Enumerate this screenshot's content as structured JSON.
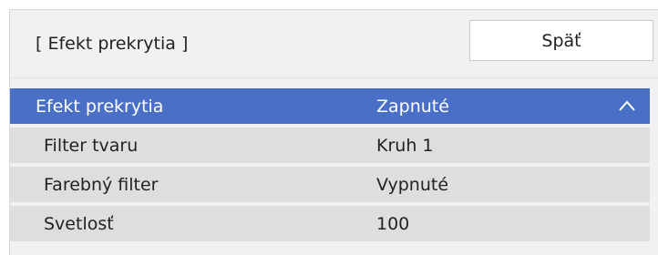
{
  "header": {
    "title": "[ Efekt prekrytia ]",
    "back_label": "Späť"
  },
  "menu": {
    "items": [
      {
        "label": "Efekt prekrytia",
        "value": "Zapnuté",
        "selected": true,
        "icon": "chevron-up-icon"
      },
      {
        "label": "Filter tvaru",
        "value": "Kruh 1"
      },
      {
        "label": "Farebný filter",
        "value": "Vypnuté"
      },
      {
        "label": "Svetlosť",
        "value": "100"
      }
    ]
  },
  "colors": {
    "selected_row": "#4a6fc7",
    "row": "#dedede",
    "panel": "#f1f1f1"
  }
}
